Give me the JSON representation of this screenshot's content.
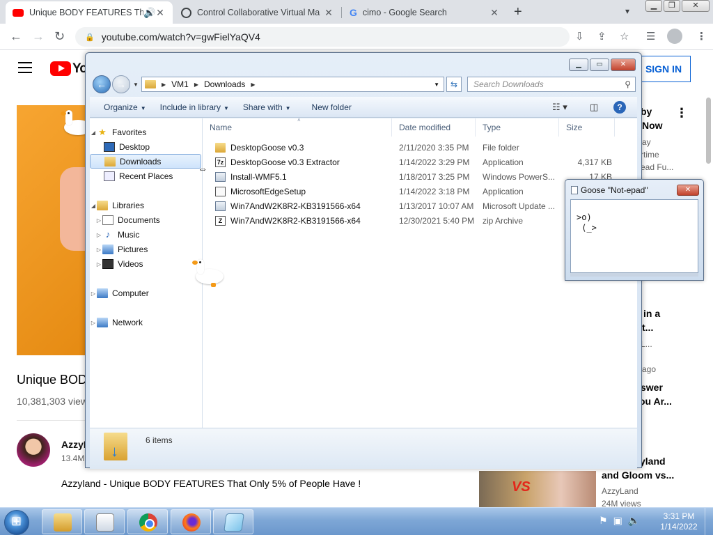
{
  "browser": {
    "tabs": [
      {
        "title": "Unique BODY FEATURES Tha",
        "icon": "youtube-icon"
      },
      {
        "title": "Control Collaborative Virtual Ma",
        "icon": "vm-icon"
      },
      {
        "title": "cimo - Google Search",
        "icon": "google-icon"
      }
    ],
    "new_tab_label": "+",
    "url": "youtube.com/watch?v=gwFielYaQV4"
  },
  "youtube": {
    "logo_text": "Yo",
    "sign_in": "SIGN IN",
    "video_title": "Unique BODY",
    "views": "10,381,303 view",
    "channel_name": "AzzyL",
    "channel_subs": "13.4M",
    "description": "Azzyland - Unique BODY FEATURES That Only 5% of People Have !",
    "sidebar": [
      {
        "text": "by",
        "style": "b"
      },
      {
        "text": "Now",
        "style": "b"
      },
      {
        "text": "ay",
        "style": "g"
      },
      {
        "text": "rtime",
        "style": "g"
      },
      {
        "text": "ead Fu...",
        "style": "g"
      },
      {
        "text": "in a",
        "style": "b"
      },
      {
        "text": "t...",
        "style": "b"
      },
      {
        "text": "L...",
        "style": "g"
      },
      {
        "text": "ago",
        "style": "g"
      },
      {
        "text": "swer",
        "style": "b"
      },
      {
        "text": "ou Ar...",
        "style": "b"
      },
      {
        "text": "zyland",
        "style": "b"
      },
      {
        "text": "and Gloom vs...",
        "style": "b"
      },
      {
        "text": "AzzyLand",
        "style": "g"
      },
      {
        "text": "24M views",
        "style": "g"
      }
    ],
    "thumb_text": "VS"
  },
  "explorer": {
    "path": [
      "VM1",
      "Downloads"
    ],
    "search_placeholder": "Search Downloads",
    "commands": [
      "Organize",
      "Include in library",
      "Share with",
      "New folder"
    ],
    "nav": {
      "favorites": "Favorites",
      "desktop": "Desktop",
      "downloads": "Downloads",
      "recent": "Recent Places",
      "libraries": "Libraries",
      "documents": "Documents",
      "music": "Music",
      "pictures": "Pictures",
      "videos": "Videos",
      "computer": "Computer",
      "network": "Network"
    },
    "columns": {
      "name": "Name",
      "date": "Date modified",
      "type": "Type",
      "size": "Size"
    },
    "files": [
      {
        "name": "DesktopGoose v0.3",
        "date": "2/11/2020 3:35 PM",
        "type": "File folder",
        "size": "",
        "kind": "folder"
      },
      {
        "name": "DesktopGoose v0.3 Extractor",
        "date": "1/14/2022 3:29 PM",
        "type": "Application",
        "size": "4,317 KB",
        "kind": "app"
      },
      {
        "name": "Install-WMF5.1",
        "date": "1/18/2017 3:25 PM",
        "type": "Windows PowerS...",
        "size": "17 KB",
        "kind": "ps"
      },
      {
        "name": "MicrosoftEdgeSetup",
        "date": "1/14/2022 3:18 PM",
        "type": "Application",
        "size": "",
        "kind": "app"
      },
      {
        "name": "Win7AndW2K8R2-KB3191566-x64",
        "date": "1/13/2017 10:07 AM",
        "type": "Microsoft Update ...",
        "size": "",
        "kind": "ps"
      },
      {
        "name": "Win7AndW2K8R2-KB3191566-x64",
        "date": "12/30/2021 5:40 PM",
        "type": "zip Archive",
        "size": "",
        "kind": "zip"
      }
    ],
    "item_count": "6 items"
  },
  "notepad": {
    "title": "Goose \"Not-epad\"",
    "text": ">o)\n (_>"
  },
  "taskbar": {
    "time": "3:31 PM",
    "date": "1/14/2022"
  }
}
